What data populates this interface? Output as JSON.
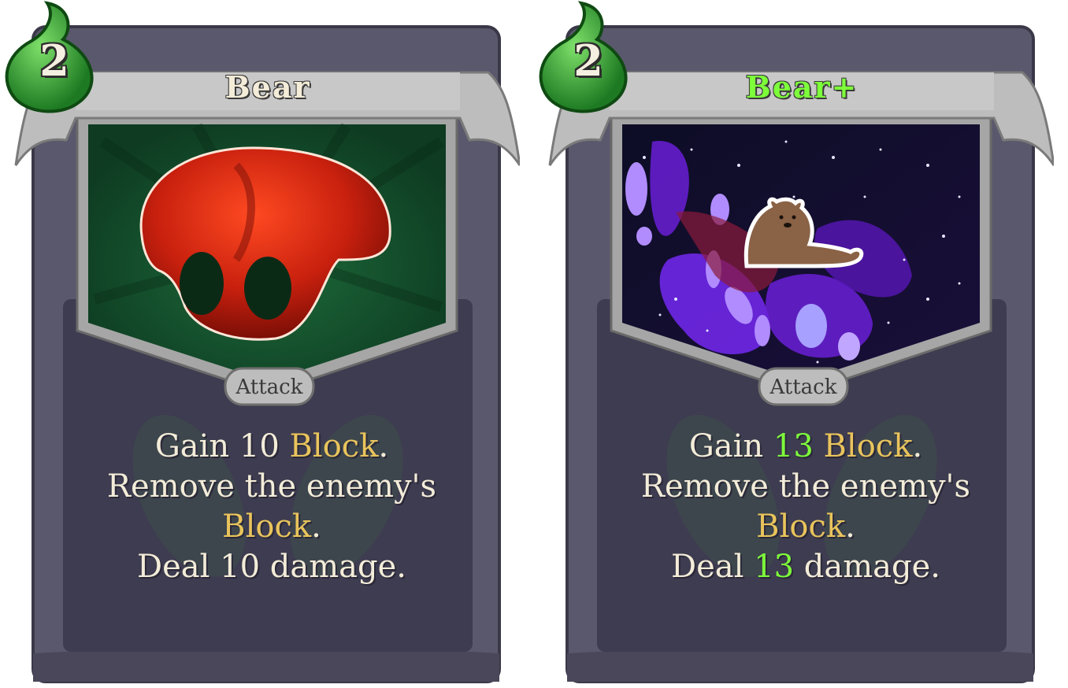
{
  "colors": {
    "title_normal": "#f3ecd8",
    "title_upgraded": "#7dff3a",
    "keyword": "#e9c45c",
    "upgraded_value": "#7dff3a",
    "card_body": "#3f3d52",
    "card_frame": "#57556a",
    "banner": "#b9b9b9",
    "energy_orb": "#2f9e2f"
  },
  "cards": [
    {
      "cost": "2",
      "title": "Bear",
      "type": "Attack",
      "art": "red-mushroom-art",
      "desc": {
        "l1a": "Gain 10 ",
        "l1b": "Block",
        "l1c": ".",
        "l2": "Remove the enemy's",
        "l3a": "Block",
        "l3b": ".",
        "l4": "Deal 10 damage."
      }
    },
    {
      "cost": "2",
      "title": "Bear+",
      "type": "Attack",
      "art": "bear-in-space-art",
      "desc": {
        "l1a": "Gain ",
        "l1n": "13",
        "l1b": " Block",
        "l1c": ".",
        "l2": "Remove the enemy's",
        "l3a": "Block",
        "l3b": ".",
        "l4a": "Deal ",
        "l4n": "13",
        "l4b": " damage."
      }
    }
  ]
}
